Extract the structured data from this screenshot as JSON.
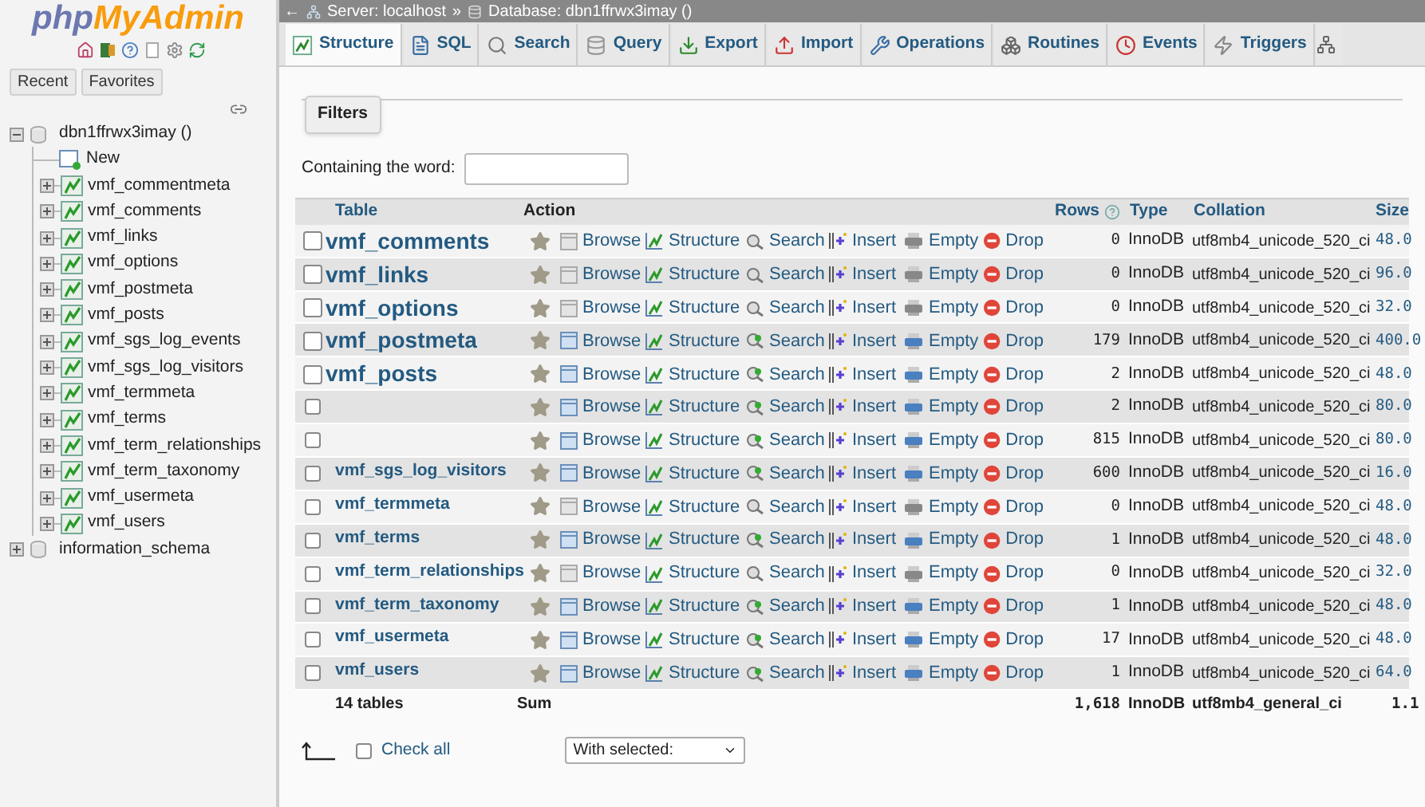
{
  "logo": [
    "php",
    "MyAdmin"
  ],
  "sidebar": {
    "buttons": [
      "Recent",
      "Favorites"
    ],
    "tree": [
      {
        "label": "dbn1ffrwx3imay ()",
        "expanded": true,
        "children": [
          {
            "label": "New",
            "kind": "new"
          },
          {
            "label": "vmf_commentmeta",
            "kind": "table"
          },
          {
            "label": "vmf_comments",
            "kind": "table"
          },
          {
            "label": "vmf_links",
            "kind": "table"
          },
          {
            "label": "vmf_options",
            "kind": "table"
          },
          {
            "label": "vmf_postmeta",
            "kind": "table"
          },
          {
            "label": "vmf_posts",
            "kind": "table"
          },
          {
            "label": "vmf_sgs_log_events",
            "kind": "table"
          },
          {
            "label": "vmf_sgs_log_visitors",
            "kind": "table"
          },
          {
            "label": "vmf_termmeta",
            "kind": "table"
          },
          {
            "label": "vmf_terms",
            "kind": "table"
          },
          {
            "label": "vmf_term_relationships",
            "kind": "table"
          },
          {
            "label": "vmf_term_taxonomy",
            "kind": "table"
          },
          {
            "label": "vmf_usermeta",
            "kind": "table"
          },
          {
            "label": "vmf_users",
            "kind": "table"
          }
        ]
      },
      {
        "label": "information_schema",
        "expanded": false
      }
    ]
  },
  "breadcrumb": {
    "back": "←",
    "server": "Server: localhost",
    "separator": "»",
    "database": "Database: dbn1ffrwx3imay ()"
  },
  "tabs": [
    {
      "label": "Structure",
      "selected": true
    },
    {
      "label": "SQL",
      "selected": false
    },
    {
      "label": "Search",
      "selected": false
    },
    {
      "label": "Query",
      "selected": false
    },
    {
      "label": "Export",
      "selected": false
    },
    {
      "label": "Import",
      "selected": false
    },
    {
      "label": "Operations",
      "selected": false
    },
    {
      "label": "Routines",
      "selected": false
    },
    {
      "label": "Events",
      "selected": false
    },
    {
      "label": "Triggers",
      "selected": false
    }
  ],
  "filters": {
    "title": "Filters",
    "label": "Containing the word:"
  },
  "table": {
    "columns": [
      "Table",
      "Action",
      "Rows",
      "Type",
      "Collation",
      "Size"
    ],
    "rows": [
      {
        "name": "vmf_comments",
        "checked": false,
        "magnified": true,
        "has_data": false,
        "actions": [
          "Browse",
          "Structure",
          "Search",
          "Insert",
          "Empty",
          "Drop"
        ],
        "rows": "0",
        "type": "InnoDB",
        "collation": "utf8mb4_unicode_520_ci",
        "size": "48.0"
      },
      {
        "name": "vmf_links",
        "checked": false,
        "magnified": true,
        "has_data": false,
        "actions": [
          "Browse",
          "Structure",
          "Search",
          "Insert",
          "Empty",
          "Drop"
        ],
        "rows": "0",
        "type": "InnoDB",
        "collation": "utf8mb4_unicode_520_ci",
        "size": "96.0"
      },
      {
        "name": "vmf_options",
        "checked": false,
        "magnified": true,
        "has_data": false,
        "actions": [
          "Browse",
          "Structure",
          "Search",
          "Insert",
          "Empty",
          "Drop"
        ],
        "rows": "0",
        "type": "InnoDB",
        "collation": "utf8mb4_unicode_520_ci",
        "size": "32.0"
      },
      {
        "name": "vmf_postmeta",
        "checked": false,
        "magnified": true,
        "has_data": true,
        "actions": [
          "Browse",
          "Structure",
          "Search",
          "Insert",
          "Empty",
          "Drop"
        ],
        "rows": "179",
        "type": "InnoDB",
        "collation": "utf8mb4_unicode_520_ci",
        "size": "400.0"
      },
      {
        "name": "vmf_posts",
        "checked": false,
        "magnified": true,
        "has_data": true,
        "actions": [
          "Browse",
          "Structure",
          "Search",
          "Insert",
          "Empty",
          "Drop"
        ],
        "rows": "2",
        "type": "InnoDB",
        "collation": "utf8mb4_unicode_520_ci",
        "size": "48.0"
      },
      {
        "checked": false,
        "magnified": false,
        "has_data": true,
        "actions": [
          "Browse",
          "Structure",
          "Search",
          "Insert",
          "Empty",
          "Drop"
        ],
        "rows": "2",
        "type": "InnoDB",
        "collation": "utf8mb4_unicode_520_ci",
        "size": "80.0"
      },
      {
        "checked": false,
        "magnified": false,
        "has_data": true,
        "actions": [
          "Browse",
          "Structure",
          "Search",
          "Insert",
          "Empty",
          "Drop"
        ],
        "rows": "815",
        "type": "InnoDB",
        "collation": "utf8mb4_unicode_520_ci",
        "size": "80.0"
      },
      {
        "name": "vmf_sgs_log_visitors",
        "checked": false,
        "magnified": false,
        "has_data": true,
        "actions": [
          "Browse",
          "Structure",
          "Search",
          "Insert",
          "Empty",
          "Drop"
        ],
        "rows": "600",
        "type": "InnoDB",
        "collation": "utf8mb4_unicode_520_ci",
        "size": "16.0"
      },
      {
        "name": "vmf_termmeta",
        "checked": false,
        "magnified": false,
        "has_data": false,
        "actions": [
          "Browse",
          "Structure",
          "Search",
          "Insert",
          "Empty",
          "Drop"
        ],
        "rows": "0",
        "type": "InnoDB",
        "collation": "utf8mb4_unicode_520_ci",
        "size": "48.0"
      },
      {
        "name": "vmf_terms",
        "checked": false,
        "magnified": false,
        "has_data": true,
        "actions": [
          "Browse",
          "Structure",
          "Search",
          "Insert",
          "Empty",
          "Drop"
        ],
        "rows": "1",
        "type": "InnoDB",
        "collation": "utf8mb4_unicode_520_ci",
        "size": "48.0"
      },
      {
        "name": "vmf_term_relationships",
        "checked": false,
        "magnified": false,
        "has_data": false,
        "actions": [
          "Browse",
          "Structure",
          "Search",
          "Insert",
          "Empty",
          "Drop"
        ],
        "rows": "0",
        "type": "InnoDB",
        "collation": "utf8mb4_unicode_520_ci",
        "size": "32.0"
      },
      {
        "name": "vmf_term_taxonomy",
        "checked": false,
        "magnified": false,
        "has_data": true,
        "actions": [
          "Browse",
          "Structure",
          "Search",
          "Insert",
          "Empty",
          "Drop"
        ],
        "rows": "1",
        "type": "InnoDB",
        "collation": "utf8mb4_unicode_520_ci",
        "size": "48.0"
      },
      {
        "name": "vmf_usermeta",
        "checked": false,
        "magnified": false,
        "has_data": true,
        "actions": [
          "Browse",
          "Structure",
          "Search",
          "Insert",
          "Empty",
          "Drop"
        ],
        "rows": "17",
        "type": "InnoDB",
        "collation": "utf8mb4_unicode_520_ci",
        "size": "48.0"
      },
      {
        "name": "vmf_users",
        "checked": false,
        "magnified": false,
        "has_data": true,
        "actions": [
          "Browse",
          "Structure",
          "Search",
          "Insert",
          "Empty",
          "Drop"
        ],
        "rows": "1",
        "type": "InnoDB",
        "collation": "utf8mb4_unicode_520_ci",
        "size": "64.0"
      }
    ],
    "summary": {
      "tables": "14 tables",
      "sum": "Sum",
      "rows": "1,618",
      "type": "InnoDB",
      "collation": "utf8mb4_general_ci",
      "size": "1.1"
    }
  },
  "footer": {
    "check_all": "Check all",
    "check_all_checked": false,
    "with_selected": "With selected:"
  }
}
